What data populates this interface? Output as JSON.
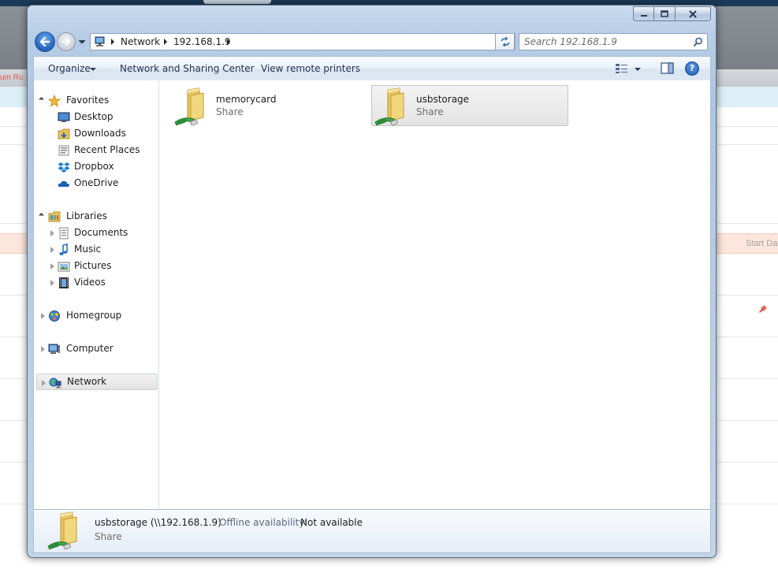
{
  "background_page": {
    "strip_text": "um Ru",
    "column_header": "Start Dat"
  },
  "window": {
    "caption_buttons": [
      "minimize",
      "maximize",
      "close"
    ]
  },
  "address_bar": {
    "breadcrumbs": [
      "Network",
      "192.168.1.9"
    ]
  },
  "search": {
    "placeholder": "Search 192.168.1.9"
  },
  "command_bar": {
    "organize": "Organize",
    "network_sharing": "Network and Sharing Center",
    "view_printers": "View remote printers",
    "help": "?"
  },
  "nav_pane": {
    "favorites": {
      "label": "Favorites",
      "items": [
        "Desktop",
        "Downloads",
        "Recent Places",
        "Dropbox",
        "OneDrive"
      ]
    },
    "libraries": {
      "label": "Libraries",
      "items": [
        "Documents",
        "Music",
        "Pictures",
        "Videos"
      ]
    },
    "homegroup": "Homegroup",
    "computer": "Computer",
    "network": "Network"
  },
  "content": {
    "items": [
      {
        "name": "memorycard",
        "type": "Share",
        "selected": false
      },
      {
        "name": "usbstorage",
        "type": "Share",
        "selected": true
      }
    ]
  },
  "details_pane": {
    "name": "usbstorage (\\\\192.168.1.9)",
    "offline_label": "Offline availability:",
    "offline_value": "Not available",
    "type": "Share"
  },
  "colors": {
    "window_frame": "#b7cde6",
    "selection": "#e4e4e4",
    "link_text": "#1e3050"
  }
}
